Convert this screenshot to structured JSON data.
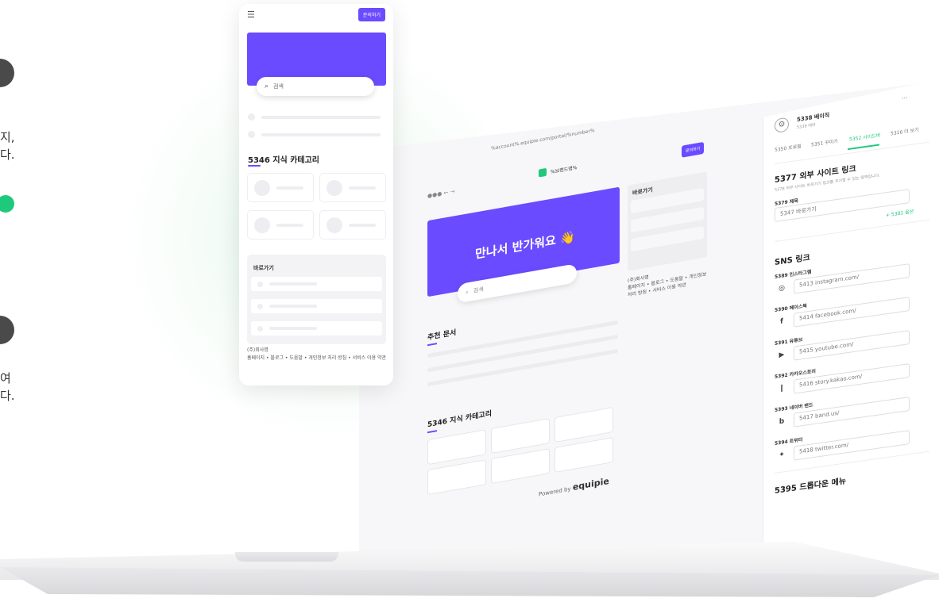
{
  "side": {
    "text1_l1": "지,",
    "text1_l2": "다.",
    "text2_l1": "여",
    "text2_l2": "다."
  },
  "mobile": {
    "menu_icon": "menu-icon",
    "contact_button": "문의하기",
    "search_placeholder": "검색",
    "category_title": "5346 지식 카테고리",
    "shortcuts_title": "바로가기",
    "company": "(주)회사명",
    "footer_links": "홈페이지 • 블로그 • 도움말 • 개인정보 처리 방침 • 서비스 이용 약관"
  },
  "web": {
    "url": "%account%.equipie.com/portal/%number%",
    "brand": "%브랜드명%",
    "contact_button": "문의하기",
    "hero_title": "만나서 반가워요 👋",
    "search_placeholder": "검색",
    "shortcuts_title": "바로가기",
    "company": "(주)회사명",
    "footer_links": "홈페이지 • 블로그 • 도움말 • 개인정보 처리 방침 • 서비스 이용 약관",
    "recommended_title": "추천 문서",
    "category_title": "5346 지식 카테고리",
    "powered_by": "Powered by",
    "powered_brand": "equipie"
  },
  "panel": {
    "page_name": "5338 베이직",
    "theme": "5339 테마",
    "more": "...",
    "tabs": [
      "5350 프로필",
      "5351 꾸미기",
      "5352 사이드바",
      "5316 더 보기"
    ],
    "external_title": "5377 외부 사이트 링크",
    "external_desc": "5378 외부 사이트 바로가기 링크를 추가할 수 있는 영역입니다.",
    "title_label": "5379 제목",
    "title_value": "5347 바로가기",
    "add_option": "+ 5381 옵션",
    "sns_title": "SNS 링크",
    "sns": [
      {
        "label": "5389 인스타그램",
        "icon": "instagram-icon",
        "value": "5413 instagram.com/"
      },
      {
        "label": "5390 페이스북",
        "icon": "facebook-icon",
        "value": "5414 facebook.com/"
      },
      {
        "label": "5391 유튜브",
        "icon": "youtube-icon",
        "value": "5415 youtube.com/"
      },
      {
        "label": "5392 카카오스토리",
        "icon": "kakaostory-icon",
        "value": "5416 story.kakao.com/"
      },
      {
        "label": "5393 네이버 밴드",
        "icon": "band-icon",
        "value": "5417 band.us/"
      },
      {
        "label": "5394 트위터",
        "icon": "twitter-icon",
        "value": "5418 twitter.com/"
      }
    ],
    "dropdown_title": "5395 드롭다운 메뉴"
  },
  "colors": {
    "brand_purple": "#6b4bff",
    "accent_green": "#1fc97b"
  }
}
